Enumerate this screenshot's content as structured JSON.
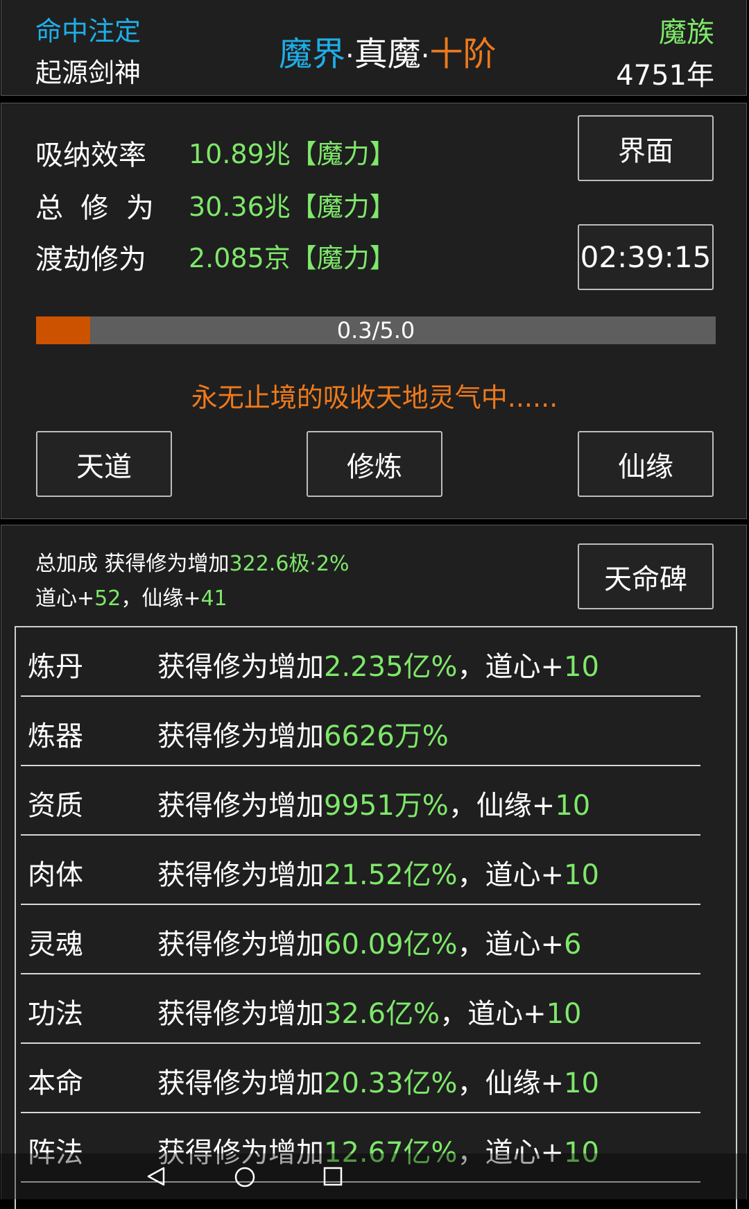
{
  "header": {
    "fate_label": "命中注定",
    "fate_value": "起源剑神",
    "realm_world": "魔界",
    "realm_sep1": "·",
    "realm_stage": "真魔",
    "realm_sep2": "·",
    "realm_level": "十阶",
    "race": "魔族",
    "year": "4751年"
  },
  "stats": {
    "absorb_label": "吸纳效率",
    "absorb_value": "10.89兆【魔力】",
    "total_label": "总  修  为",
    "total_value": "30.36兆【魔力】",
    "tribulation_label": "渡劫修为",
    "tribulation_value": "2.085京【魔力】",
    "interface_button": "界面",
    "timer": "02:39:15",
    "progress_text": "0.3/5.0",
    "progress_value": 0.3,
    "progress_max": 5.0,
    "status_message": "永无止境的吸收天地灵气中......",
    "buttons": [
      "天道",
      "修炼",
      "仙缘"
    ]
  },
  "bonus": {
    "summary_prefix": "总加成 获得修为增加",
    "summary_value": "322.6极·2%",
    "dao_label": "道心+",
    "dao_value": "52",
    "sep": "，",
    "fate_label": "仙缘+",
    "fate_value": "41",
    "tablet_button": "天命碑",
    "rows": [
      {
        "name": "炼丹",
        "prefix": "获得修为增加",
        "value": "2.235亿%",
        "suffix": "，道心+",
        "extra": "10"
      },
      {
        "name": "炼器",
        "prefix": "获得修为增加",
        "value": "6626万%",
        "suffix": "",
        "extra": ""
      },
      {
        "name": "资质",
        "prefix": "获得修为增加",
        "value": "9951万%",
        "suffix": "，仙缘+",
        "extra": "10"
      },
      {
        "name": "肉体",
        "prefix": "获得修为增加",
        "value": "21.52亿%",
        "suffix": "，道心+",
        "extra": "10"
      },
      {
        "name": "灵魂",
        "prefix": "获得修为增加",
        "value": "60.09亿%",
        "suffix": "，道心+",
        "extra": "6"
      },
      {
        "name": "功法",
        "prefix": "获得修为增加",
        "value": "32.6亿%",
        "suffix": "，道心+",
        "extra": "10"
      },
      {
        "name": "本命",
        "prefix": "获得修为增加",
        "value": "20.33亿%",
        "suffix": "，仙缘+",
        "extra": "10"
      },
      {
        "name": "阵法",
        "prefix": "获得修为增加",
        "value": "12.67亿%",
        "suffix": "，道心+",
        "extra": "10"
      }
    ]
  },
  "navbar": {
    "back_icon": "triangle-back-icon",
    "home_icon": "circle-home-icon",
    "recent_icon": "square-recent-icon"
  },
  "colors": {
    "cyan": "#1eaee8",
    "green": "#7ee86a",
    "orange": "#ee7a1c",
    "progress_fill": "#cc5200"
  }
}
